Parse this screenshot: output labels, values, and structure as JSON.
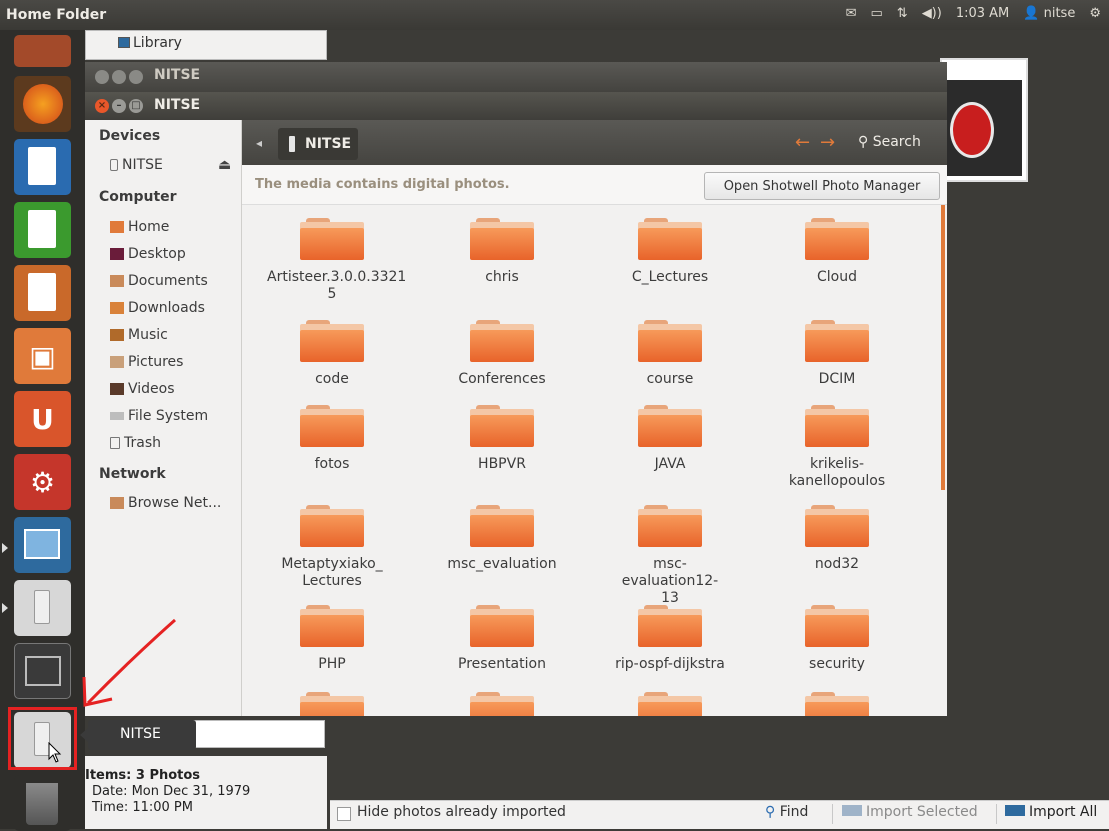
{
  "top_panel": {
    "title": "Home Folder",
    "indicators": {
      "mail": "✉",
      "battery": "▭",
      "network": "⇅",
      "sound": "◀))",
      "time": "1:03 AM",
      "user_icon": "👤",
      "user": "nitse",
      "gear": "⚙"
    }
  },
  "launcher": {
    "items": [
      "firefox-icon",
      "libreoffice-writer-icon",
      "libreoffice-calc-icon",
      "libreoffice-impress-icon",
      "software-center-icon",
      "ubuntu-one-icon",
      "system-settings-icon",
      "shotwell-icon",
      "usb-drive-icon",
      "workspace-switcher-icon",
      "usb-drive-icon",
      "trash-icon"
    ],
    "colors": {
      "firefox": "#e06a1a",
      "writer": "#2a6bb0",
      "calc": "#3b9a2e",
      "impress": "#c9692a",
      "software": "#e07a3a",
      "ubuntu_one": "#d9552b",
      "settings": "#c5362b",
      "shotwell": "#2e6a9e",
      "usb": "#d7d7d7",
      "workspace": "#3a3a3a",
      "trash": "#6a6a6a"
    }
  },
  "shotwell": {
    "library_label": "Library",
    "info": {
      "items": "Items: 3 Photos",
      "date": "Date: Mon Dec 31, 1979",
      "time": "Time: 11:00 PM"
    },
    "bottom": {
      "hide_label": "Hide photos already imported",
      "find_label": "Find",
      "import_selected": "Import Selected",
      "import_all": "Import All"
    }
  },
  "window_back": {
    "title": "NITSE"
  },
  "window_front": {
    "title": "NITSE",
    "sidebar": {
      "devices_header": "Devices",
      "devices": [
        "NITSE"
      ],
      "eject": "⏏",
      "computer_header": "Computer",
      "computer": [
        "Home",
        "Desktop",
        "Documents",
        "Downloads",
        "Music",
        "Pictures",
        "Videos",
        "File System",
        "Trash"
      ],
      "network_header": "Network",
      "network": [
        "Browse Net..."
      ]
    },
    "toolbar": {
      "path": "NITSE",
      "back": "←",
      "forward": "→",
      "search": "Search"
    },
    "infobar": {
      "message": "The media contains digital photos.",
      "button": "Open Shotwell Photo Manager"
    },
    "folders": [
      [
        "Artisteer.3.0.0.3321",
        "5"
      ],
      [
        "chris"
      ],
      [
        "C_Lectures"
      ],
      [
        "Cloud"
      ],
      [
        "code"
      ],
      [
        "Conferences"
      ],
      [
        "course"
      ],
      [
        "DCIM"
      ],
      [
        "fotos"
      ],
      [
        "HBPVR"
      ],
      [
        "JAVA"
      ],
      [
        "krikelis-",
        "kanellopoulos"
      ],
      [
        "Metaptyxiako_",
        "Lectures"
      ],
      [
        "msc_evaluation"
      ],
      [
        "msc-evaluation12-",
        "13"
      ],
      [
        "nod32"
      ],
      [
        "PHP"
      ],
      [
        "Presentation"
      ],
      [
        "rip-ospf-dijkstra"
      ],
      [
        "security"
      ]
    ]
  },
  "tooltip": {
    "label": "NITSE"
  }
}
